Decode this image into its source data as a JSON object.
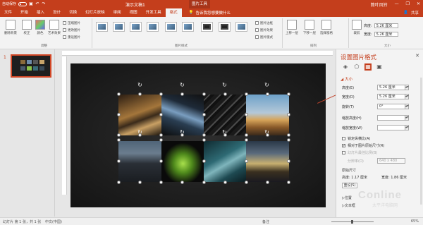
{
  "titlebar": {
    "autosave": "自动保存",
    "autosave_state": "关",
    "doc_title": "演示文稿1",
    "context_group": "图片工具",
    "user": "簡叶风铃",
    "min": "—",
    "restore": "❐",
    "close": "✕"
  },
  "tabs": [
    "文件",
    "开始",
    "插入",
    "设计",
    "切换",
    "幻灯片放映",
    "审阅",
    "视图",
    "开发工具",
    "格式"
  ],
  "tellme": "告诉我您想要做什么",
  "share": "共享",
  "ribbon": {
    "remove_bg": "删除背景",
    "correct": "校正",
    "color": "颜色",
    "art_effects": "艺术效果",
    "compress": "压缩图片",
    "change_pic": "更改图片",
    "reset_pic": "重设图片",
    "group_adjust": "调整",
    "group_styles": "图片样式",
    "pic_border": "图片边框",
    "pic_effects": "图片效果",
    "pic_layout": "图片版式",
    "bring_forward": "上移一层",
    "send_backward": "下移一层",
    "selection_pane": "选择窗格",
    "group_arrange": "排列",
    "crop": "裁剪",
    "height_label": "高度:",
    "height_value": "5.26 厘米",
    "width_label": "宽度:",
    "width_value": "5.26 厘米",
    "group_size": "大小"
  },
  "thumbnail": {
    "number": "1"
  },
  "format_pane": {
    "title": "设置图片格式",
    "close": "✕",
    "section_size": "大小",
    "height_label": "高度(E)",
    "height_value": "5.26 厘米",
    "width_label": "宽度(D)",
    "width_value": "5.26 厘米",
    "rotation_label": "旋转(T)",
    "rotation_value": "0°",
    "scale_h_label": "缩放高度(H)",
    "scale_w_label": "缩放宽度(W)",
    "lock_aspect": "锁定纵横比(A)",
    "relative_original": "相对于图片原始尺寸(R)",
    "best_scale": "幻灯片最佳比例(B)",
    "resolution_label": "分辨率(O)",
    "resolution_value": "640 x 480",
    "original_size": "原始尺寸",
    "orig_height": "高度: 1.17 厘米",
    "orig_width": "宽度: 1.86 厘米",
    "reset": "重设(S)",
    "section_position": "位置",
    "section_textbox": "文本框"
  },
  "status": {
    "slide_info": "幻灯片 第 1 张，共 1 张",
    "language": "中文(中国)",
    "notes": "备注",
    "zoom": "65%"
  },
  "watermark": {
    "brand": "Conline",
    "sub": "太平洋电脑网"
  },
  "colors": {
    "accent": "#c43e1c",
    "slide_bg": "#1f1f1f"
  }
}
